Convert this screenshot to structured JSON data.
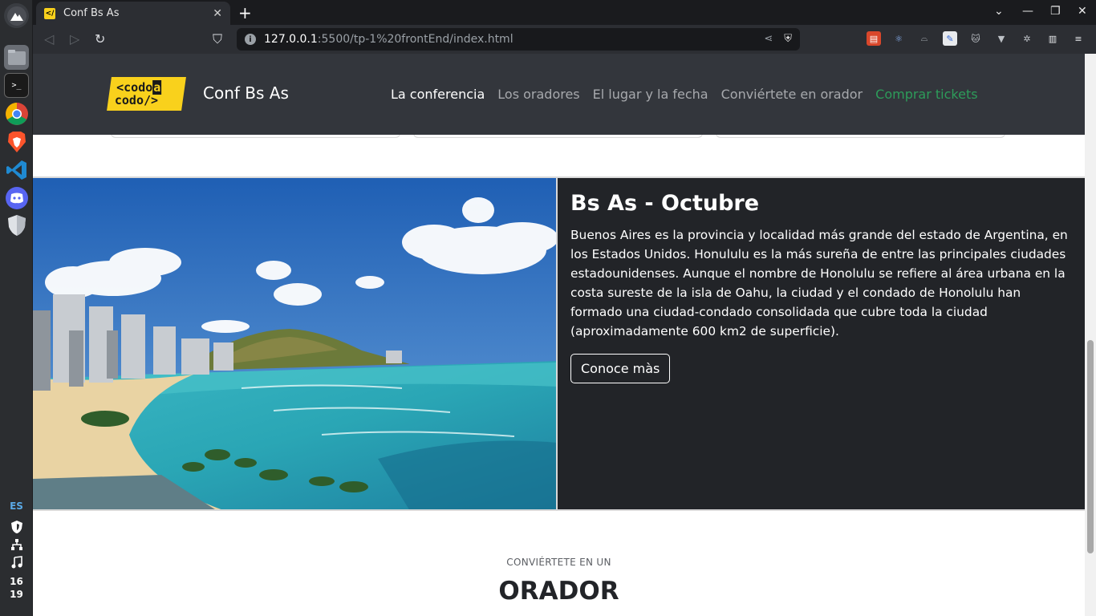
{
  "browser": {
    "tab_title": "Conf Bs As",
    "tab_favicon": "codo-a-codo-favicon",
    "url_host": "127.0.0.1",
    "url_path": ":5500/tp-1%20frontEnd/index.html"
  },
  "dock": {
    "tray_lang": "ES",
    "clock_hour": "16",
    "clock_minute": "19"
  },
  "navbar": {
    "logo_line1": "<codo",
    "logo_line1_suffix": "a",
    "logo_line2": "codo/>",
    "brand": "Conf Bs As",
    "links": [
      {
        "label": "La conferencia",
        "state": "active"
      },
      {
        "label": "Los oradores",
        "state": "normal"
      },
      {
        "label": "El lugar y la fecha",
        "state": "normal"
      },
      {
        "label": "Conviértete en orador",
        "state": "normal"
      },
      {
        "label": "Comprar tickets",
        "state": "accent"
      }
    ]
  },
  "feature": {
    "image_alt": "honolulu-beach-photo",
    "title": "Bs As - Octubre",
    "description": "Buenos Aires es la provincia y localidad más grande del estado de Argentina, en los Estados Unidos. Honululu es la más sureña de entre las principales ciudades estadounidenses. Aunque el nombre de Honolulu se refiere al área urbana en la costa sureste de la isla de Oahu, la ciudad y el condado de Honolulu han formado una ciudad-condado consolidada que cubre toda la ciudad (aproximadamente 600 km2 de superficie).",
    "button": "Conoce màs"
  },
  "orador": {
    "kicker": "CONVIÉRTETE EN UN",
    "title": "ORADOR"
  },
  "colors": {
    "navbar_bg": "#33363c",
    "feature_bg": "#222428",
    "brand_yellow": "#f9d11c",
    "tickets_green": "#2d9c5a"
  }
}
